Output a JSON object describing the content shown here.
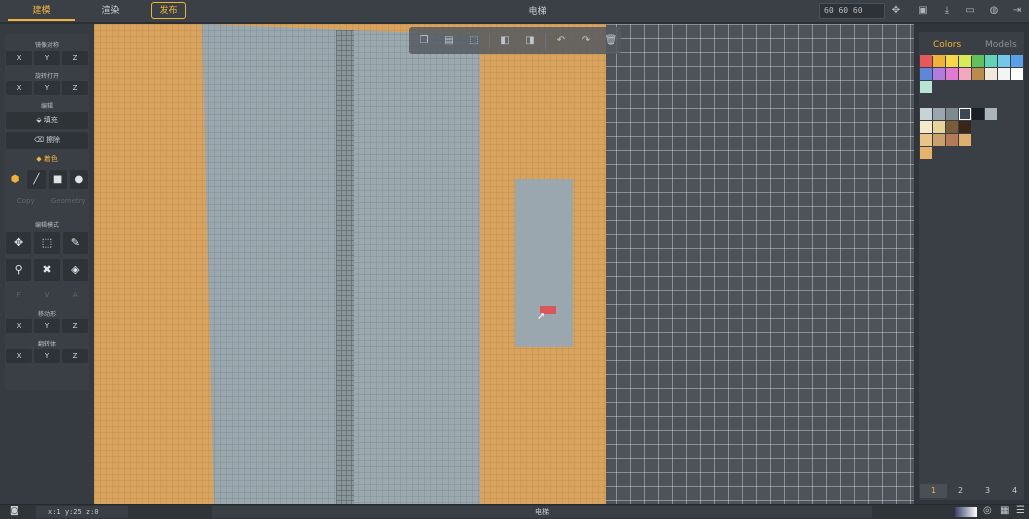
{
  "topbar": {
    "tabs": [
      "建模",
      "渲染"
    ],
    "publish_label": "发布",
    "title": "电梯",
    "dims_value": "60 60 60"
  },
  "left_panel": {
    "sections": {
      "mirror": "镜像对称",
      "rotate": "旋转打开",
      "edit": "编辑",
      "edit_mode": "编辑模式",
      "move": "移动形",
      "flip": "翻转体"
    },
    "xyz": [
      "X",
      "Y",
      "Z"
    ],
    "buttons": {
      "fill": "填充",
      "erase": "擦除",
      "paint": "着色",
      "copy": "Copy",
      "geometry": "Geometry"
    },
    "fva": [
      "F",
      "V",
      "A"
    ]
  },
  "right_panel": {
    "tab_colors": "Colors",
    "tab_models": "Models",
    "palette_top": [
      "#e85858",
      "#f2b236",
      "#f6d84a",
      "#d9ea54",
      "#5fc25c",
      "#63d3b8",
      "#73c7e8",
      "#5aa0e8",
      "#5f86d9",
      "#b17be0",
      "#e27ad4",
      "#f5a7bd",
      "#b88c4a",
      "#f0e8d8",
      "#f4f4f4",
      "#ffffff",
      "#b9e3d5"
    ],
    "palette_mid": [
      "#c7d3d6",
      "#9aa7ae",
      "#7d8a90",
      "#3d4752",
      "#1a1f27",
      "#aab4bb"
    ],
    "palette_mid2": [
      "#f3ebcc",
      "#e6d49a",
      "#7a5b3a",
      "#3a2618",
      "#e8c48a",
      "#caa06b",
      "#b37b5a",
      "#ddb070",
      "#e6b36c"
    ],
    "pages": [
      "1",
      "2",
      "3",
      "4"
    ]
  },
  "statusbar": {
    "coords": "x:1  y:25  z:0",
    "center_label": "电梯"
  }
}
